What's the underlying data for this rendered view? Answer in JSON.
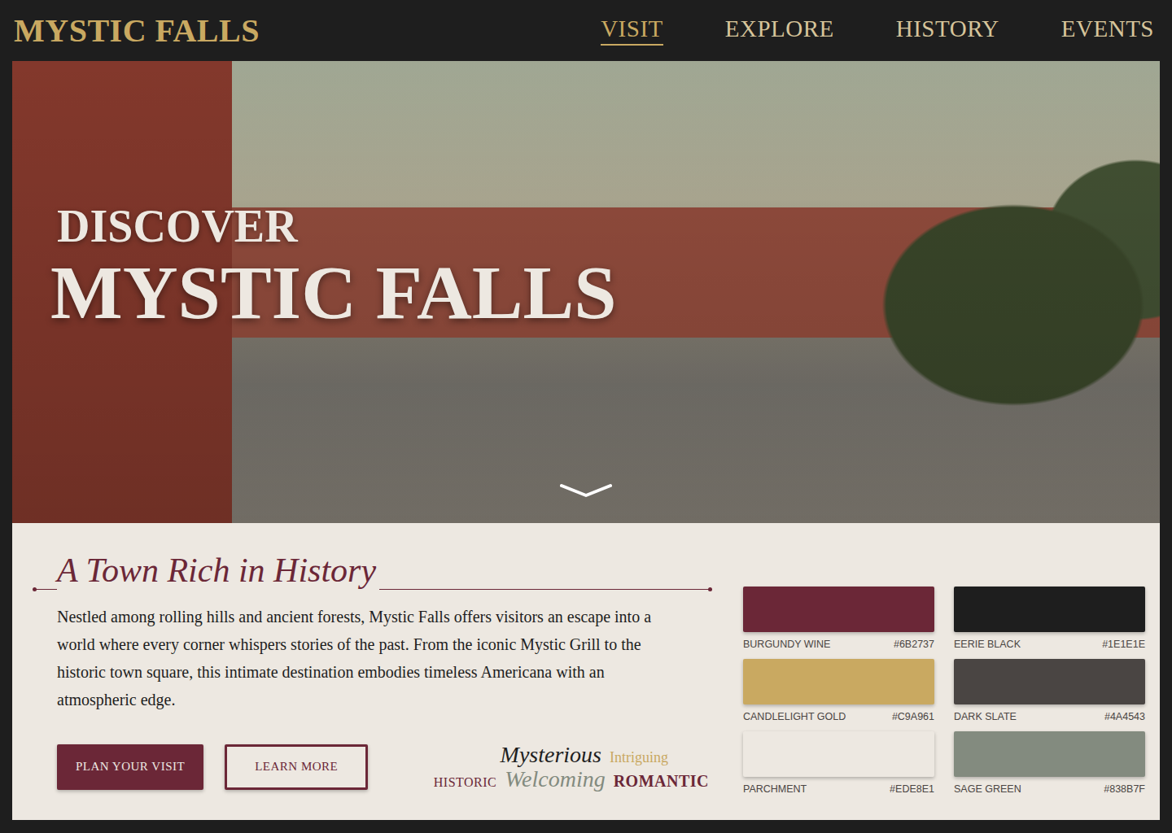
{
  "brand": "MYSTIC FALLS",
  "nav": [
    {
      "label": "VISIT",
      "selected": true
    },
    {
      "label": "EXPLORE",
      "selected": false
    },
    {
      "label": "HISTORY",
      "selected": false
    },
    {
      "label": "EVENTS",
      "selected": false
    }
  ],
  "hero": {
    "eyebrow": "DISCOVER",
    "title": "MYSTIC FALLS"
  },
  "intro": {
    "heading": "A Town Rich in History",
    "body": "Nestled among rolling hills and ancient forests, Mystic Falls offers visitors an escape into a world where every corner whispers stories of the past. From the iconic Mystic Grill to the historic town square, this intimate destination embodies timeless Americana with an atmospheric edge.",
    "buttons": [
      {
        "label": "PLAN YOUR VISIT",
        "kind": "primary"
      },
      {
        "label": "LEARN MORE",
        "kind": "outline"
      }
    ]
  },
  "mood_lines": [
    {
      "words": [
        {
          "text": "Mysterious",
          "kind": "script",
          "color": "#1E1E1E"
        },
        {
          "text": "Intriguing",
          "kind": "small",
          "color": "#C9A961"
        }
      ]
    },
    {
      "words": [
        {
          "text": "HISTORIC",
          "kind": "caps",
          "color": "#6B2737"
        },
        {
          "text": "Welcoming",
          "kind": "script",
          "color": "#838B7F"
        },
        {
          "text": "ROMANTIC",
          "kind": "bold",
          "color": "#6B2737"
        }
      ]
    }
  ],
  "palette": [
    {
      "name": "BURGUNDY WINE",
      "hex": "#6B2737",
      "color": "#6B2737"
    },
    {
      "name": "EERIE BLACK",
      "hex": "#1E1E1E",
      "color": "#1E1E1E"
    },
    {
      "name": "CANDLELIGHT GOLD",
      "hex": "#C9A961",
      "color": "#C9A961"
    },
    {
      "name": "DARK SLATE",
      "hex": "#4A4543",
      "color": "#4A4543"
    },
    {
      "name": "PARCHMENT",
      "hex": "#EDE8E1",
      "color": "#EDE8E1"
    },
    {
      "name": "SAGE GREEN",
      "hex": "#838B7F",
      "color": "#838B7F"
    }
  ]
}
